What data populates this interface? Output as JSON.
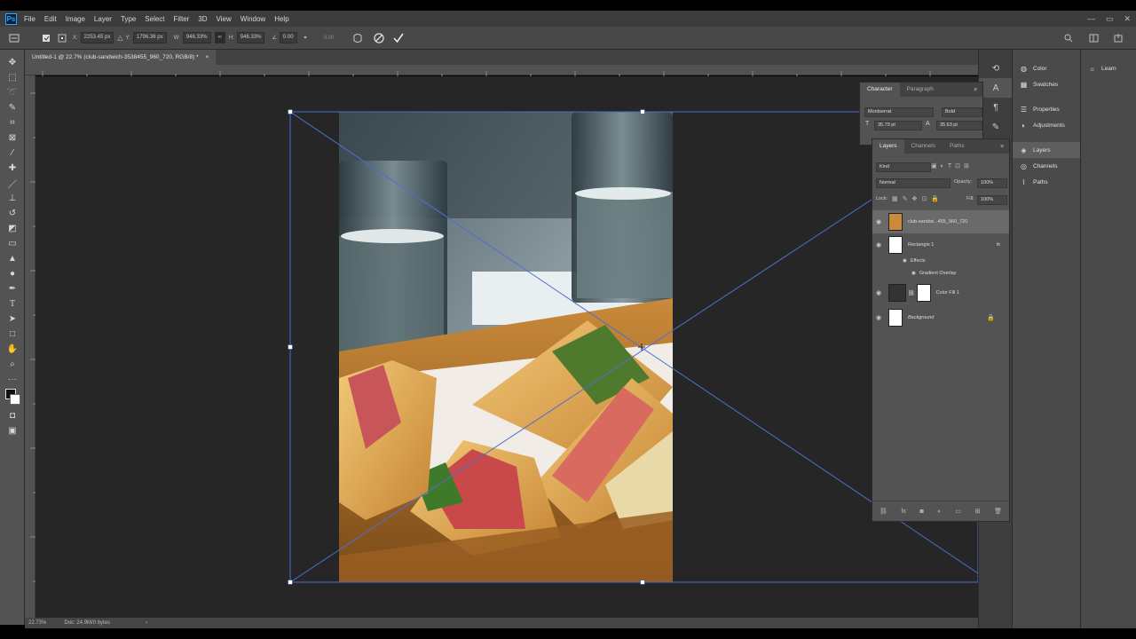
{
  "app": {
    "logo": "Ps",
    "menu": [
      "File",
      "Edit",
      "Image",
      "Layer",
      "Type",
      "Select",
      "Filter",
      "3D",
      "View",
      "Window",
      "Help"
    ],
    "window_controls": [
      "—",
      "▭",
      "✕"
    ]
  },
  "options_bar": {
    "x_label": "X:",
    "x_value": "2253.45 px",
    "y_label": "Y:",
    "y_value": "1796.36 px",
    "w_label": "W:",
    "w_value": "946.33%",
    "h_label": "H:",
    "h_value": "946.33%",
    "angle_value": "0.00",
    "interp_label": "0.00",
    "cancel_icon": "cancel-transform-icon",
    "commit_icon": "commit-checkmark-icon"
  },
  "document": {
    "tab_title": "Untitled-1 @ 22.7% (club-sandwich-3538455_960_720, RGB/8) *",
    "close": "×"
  },
  "status_bar": {
    "zoom": "22.73%",
    "doc_info": "Doc: 24.9M/0 bytes"
  },
  "character_panel": {
    "tabs": [
      "Character",
      "Paragraph"
    ],
    "font_family": "Montserrat",
    "font_style": "Bold",
    "font_size": "35.79 pt",
    "leading": "35.63 pt"
  },
  "layers_panel": {
    "tabs": [
      "Layers",
      "Channels",
      "Paths"
    ],
    "search_placeholder": "Kind",
    "blend_mode": "Normal",
    "opacity_label": "Opacity:",
    "opacity_value": "100%",
    "lock_label": "Lock:",
    "fill_label": "Fill:",
    "fill_value": "100%",
    "layers": [
      {
        "name": "club-sandwi...455_960_720",
        "selected": true
      },
      {
        "name": "Rectangle 1",
        "fx": "fx"
      },
      {
        "name": "Effects",
        "sub": true
      },
      {
        "name": "Gradient Overlay",
        "sub": true
      },
      {
        "name": "Color Fill 1"
      },
      {
        "name": "Background",
        "locked": true
      }
    ]
  },
  "dock_panels": {
    "group1": [
      "Color",
      "Swatches"
    ],
    "group2": [
      "Properties",
      "Adjustments"
    ],
    "group3": [
      "Layers",
      "Channels",
      "Paths"
    ],
    "learn": "Learn"
  },
  "tools": [
    "move-tool-icon",
    "marquee-tool-icon",
    "lasso-tool-icon",
    "quick-select-tool-icon",
    "crop-tool-icon",
    "frame-tool-icon",
    "eyedropper-tool-icon",
    "healing-brush-tool-icon",
    "brush-tool-icon",
    "clone-stamp-tool-icon",
    "history-brush-tool-icon",
    "eraser-tool-icon",
    "gradient-tool-icon",
    "blur-tool-icon",
    "dodge-tool-icon",
    "pen-tool-icon",
    "type-tool-icon",
    "path-select-tool-icon",
    "rectangle-tool-icon",
    "hand-tool-icon",
    "zoom-tool-icon"
  ]
}
